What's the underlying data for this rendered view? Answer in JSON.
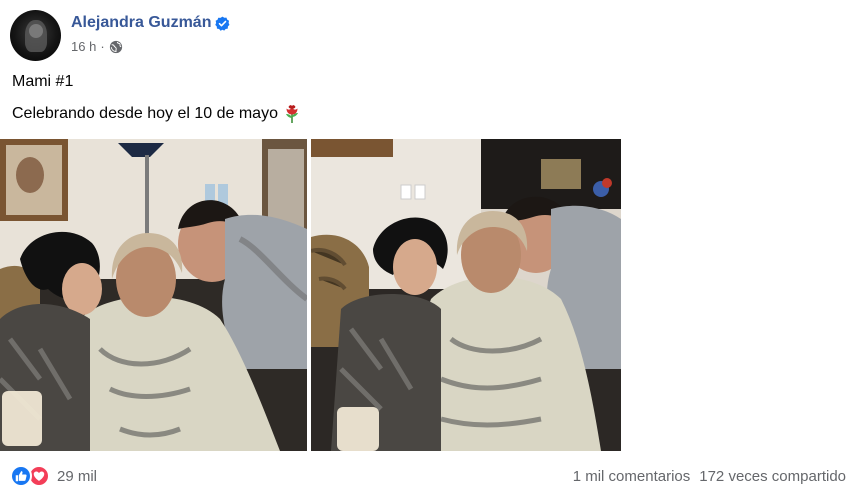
{
  "post": {
    "author": "Alejandra Guzmán",
    "timestamp": "16 h",
    "time_separator": "·",
    "privacy_icon": "globe-icon",
    "verified_icon": "verified-badge-icon",
    "lines": [
      "Mami #1",
      "Celebrando desde hoy el 10 de mayo"
    ],
    "emoji_icon": "rose-icon"
  },
  "photos": [
    {
      "description_icon": "photo-1"
    },
    {
      "description_icon": "photo-2"
    }
  ],
  "footer": {
    "reaction_icons": [
      "like-reaction-icon",
      "love-reaction-icon"
    ],
    "reaction_count": "29 mil",
    "comments": "1 mil comentarios",
    "shares": "172 veces compartido"
  },
  "colors": {
    "author_link": "#385898",
    "secondary_text": "#65676b",
    "like_blue": "#1877f2",
    "love_red": "#f33e58",
    "verified_blue": "#1877f2"
  }
}
